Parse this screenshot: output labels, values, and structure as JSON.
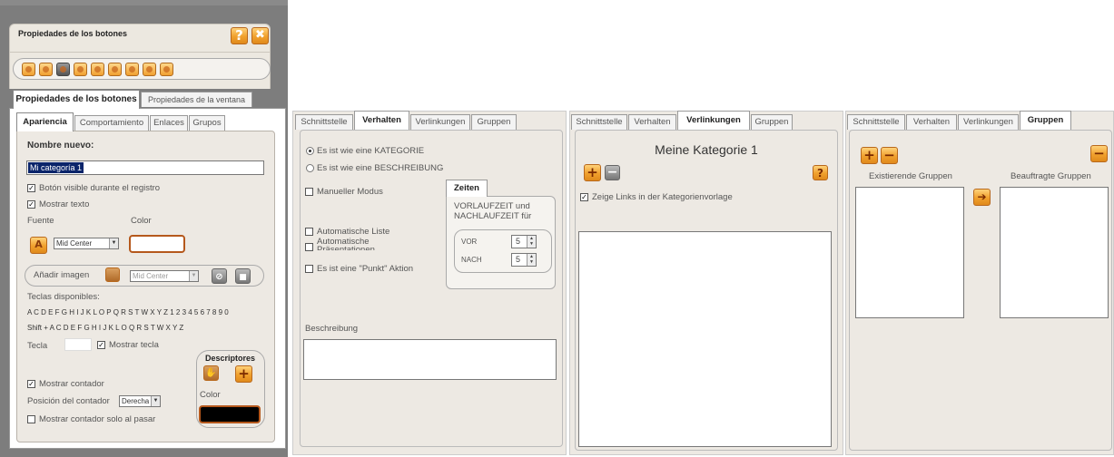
{
  "panel1": {
    "title": "Propiedades de los botones",
    "help_icon": "question-icon",
    "close_icon": "close-x-icon",
    "main_tabs": [
      "Propiedades de los botones",
      "Propiedades de la ventana"
    ],
    "sub_tabs": [
      "Apariencia",
      "Comportamiento",
      "Enlaces",
      "Grupos"
    ],
    "name_label": "Nombre nuevo:",
    "name_value": "Mi categoría 1",
    "visible_check": "Botón visible durante el registro",
    "show_text_check": "Mostrar texto",
    "font_label": "Fuente",
    "color_label": "Color",
    "font_align": "Mid Center",
    "add_image_label": "Añadir imagen",
    "image_align": "Mid Center",
    "keys_label": "Teclas disponibles:",
    "keys_row1": "A C D E F G H I J K L O P Q R S T W X Y Z 1 2 3 4 5 6 7 8 9 0",
    "keys_row2": "Shift + A C D E F G H I J K L O Q R S T W X Y Z",
    "key_label": "Tecla",
    "show_key_check": "Mostrar tecla",
    "descriptors_label": "Descriptores",
    "descriptors_color_label": "Color",
    "show_counter_check": "Mostrar contador",
    "counter_pos_label": "Posición del contador",
    "counter_pos_value": "Derecha",
    "counter_hover_check": "Mostrar contador solo al pasar",
    "font_color": "#ffffff",
    "descriptors_color": "#000000",
    "accent": "#f0a030"
  },
  "panel2": {
    "tabs": [
      "Schnittstelle",
      "Verhalten",
      "Verlinkungen",
      "Gruppen"
    ],
    "radio_category": "Es ist wie eine KATEGORIE",
    "radio_description": "Es ist wie eine BESCHREIBUNG",
    "manual_mode": "Manueller Modus",
    "auto_list": "Automatische Liste",
    "auto_presentations": "Automatische Präsentationen",
    "point_action": "Es ist eine \"Punkt\" Aktion",
    "times_tab": "Zeiten",
    "times_text": "VORLAUFZEIT und NACHLAUFZEIT für",
    "before_label": "VOR",
    "before_value": "5",
    "after_label": "NACH",
    "after_value": "5",
    "description_label": "Beschreibung"
  },
  "panel3": {
    "tabs": [
      "Schnittstelle",
      "Verhalten",
      "Verlinkungen",
      "Gruppen"
    ],
    "title": "Meine Kategorie 1",
    "show_links": "Zeige Links in der Kategorienvorlage"
  },
  "panel4": {
    "tabs": [
      "Schnittstelle",
      "Verhalten",
      "Verlinkungen",
      "Gruppen"
    ],
    "existing_groups": "Existierende Gruppen",
    "assigned_groups": "Beauftragte Gruppen"
  }
}
